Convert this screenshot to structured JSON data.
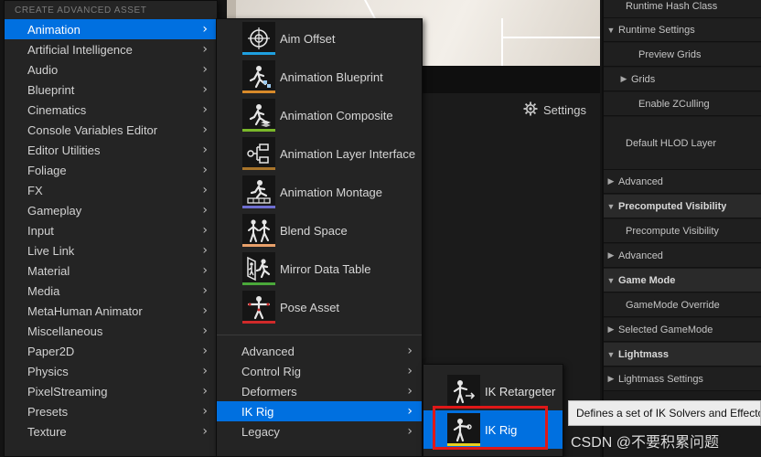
{
  "menu": {
    "header": "CREATE ADVANCED ASSET",
    "items": [
      {
        "label": "Animation"
      },
      {
        "label": "Artificial Intelligence"
      },
      {
        "label": "Audio"
      },
      {
        "label": "Blueprint"
      },
      {
        "label": "Cinematics"
      },
      {
        "label": "Console Variables Editor"
      },
      {
        "label": "Editor Utilities"
      },
      {
        "label": "Foliage"
      },
      {
        "label": "FX"
      },
      {
        "label": "Gameplay"
      },
      {
        "label": "Input"
      },
      {
        "label": "Live Link"
      },
      {
        "label": "Material"
      },
      {
        "label": "Media"
      },
      {
        "label": "MetaHuman Animator"
      },
      {
        "label": "Miscellaneous"
      },
      {
        "label": "Paper2D"
      },
      {
        "label": "Physics"
      },
      {
        "label": "PixelStreaming"
      },
      {
        "label": "Presets"
      },
      {
        "label": "Texture"
      }
    ]
  },
  "animation_menu": {
    "assets": [
      {
        "label": "Aim Offset",
        "icon": "crosshair-icon",
        "color": "#1fa0e0"
      },
      {
        "label": "Animation Blueprint",
        "icon": "animation-blueprint-icon",
        "color": "#d88a2a"
      },
      {
        "label": "Animation Composite",
        "icon": "animation-composite-icon",
        "color": "#7ab82a"
      },
      {
        "label": "Animation Layer Interface",
        "icon": "layer-interface-icon",
        "color": "#a8742a"
      },
      {
        "label": "Animation Montage",
        "icon": "animation-montage-icon",
        "color": "#6e6ed0"
      },
      {
        "label": "Blend Space",
        "icon": "blend-space-icon",
        "color": "#e8a06a"
      },
      {
        "label": "Mirror Data Table",
        "icon": "mirror-data-table-icon",
        "color": "#4aa83a"
      },
      {
        "label": "Pose Asset",
        "icon": "pose-asset-icon",
        "color": "#d02a2a"
      }
    ],
    "submenus": [
      {
        "label": "Advanced"
      },
      {
        "label": "Control Rig"
      },
      {
        "label": "Deformers"
      },
      {
        "label": "IK Rig"
      },
      {
        "label": "Legacy"
      }
    ]
  },
  "ik_menu": {
    "items": [
      {
        "label": "IK Retargeter",
        "icon": "ik-retargeter-icon"
      },
      {
        "label": "IK Rig",
        "icon": "ik-rig-icon",
        "color": "#e8d020"
      }
    ]
  },
  "toolbar": {
    "settings_label": "Settings",
    "settings_icon": "gear-icon"
  },
  "details": {
    "rows": [
      {
        "label": "Runtime Hash Class",
        "kind": "sub"
      },
      {
        "label": "Runtime Settings",
        "kind": "sub",
        "arrow": "down"
      },
      {
        "label": "Preview Grids",
        "kind": "sub"
      },
      {
        "label": "Grids",
        "kind": "sub",
        "arrow": "right"
      },
      {
        "label": "Enable ZCulling",
        "kind": "sub"
      },
      {
        "label": "Default HLOD Layer",
        "kind": "sub"
      },
      {
        "label": "Advanced",
        "kind": "sub",
        "arrow": "right"
      },
      {
        "label": "Precomputed Visibility",
        "kind": "cat",
        "arrow": "down"
      },
      {
        "label": "Precompute Visibility",
        "kind": "sub"
      },
      {
        "label": "Advanced",
        "kind": "sub",
        "arrow": "right"
      },
      {
        "label": "Game Mode",
        "kind": "cat",
        "arrow": "down"
      },
      {
        "label": "GameMode Override",
        "kind": "sub"
      },
      {
        "label": "Selected GameMode",
        "kind": "sub",
        "arrow": "right"
      },
      {
        "label": "Lightmass",
        "kind": "cat",
        "arrow": "down"
      },
      {
        "label": "Lightmass Settings",
        "kind": "sub",
        "arrow": "right"
      }
    ]
  },
  "tooltip": "Defines a set of IK Solvers and Effectors",
  "watermark": "CSDN @不要积累问题"
}
